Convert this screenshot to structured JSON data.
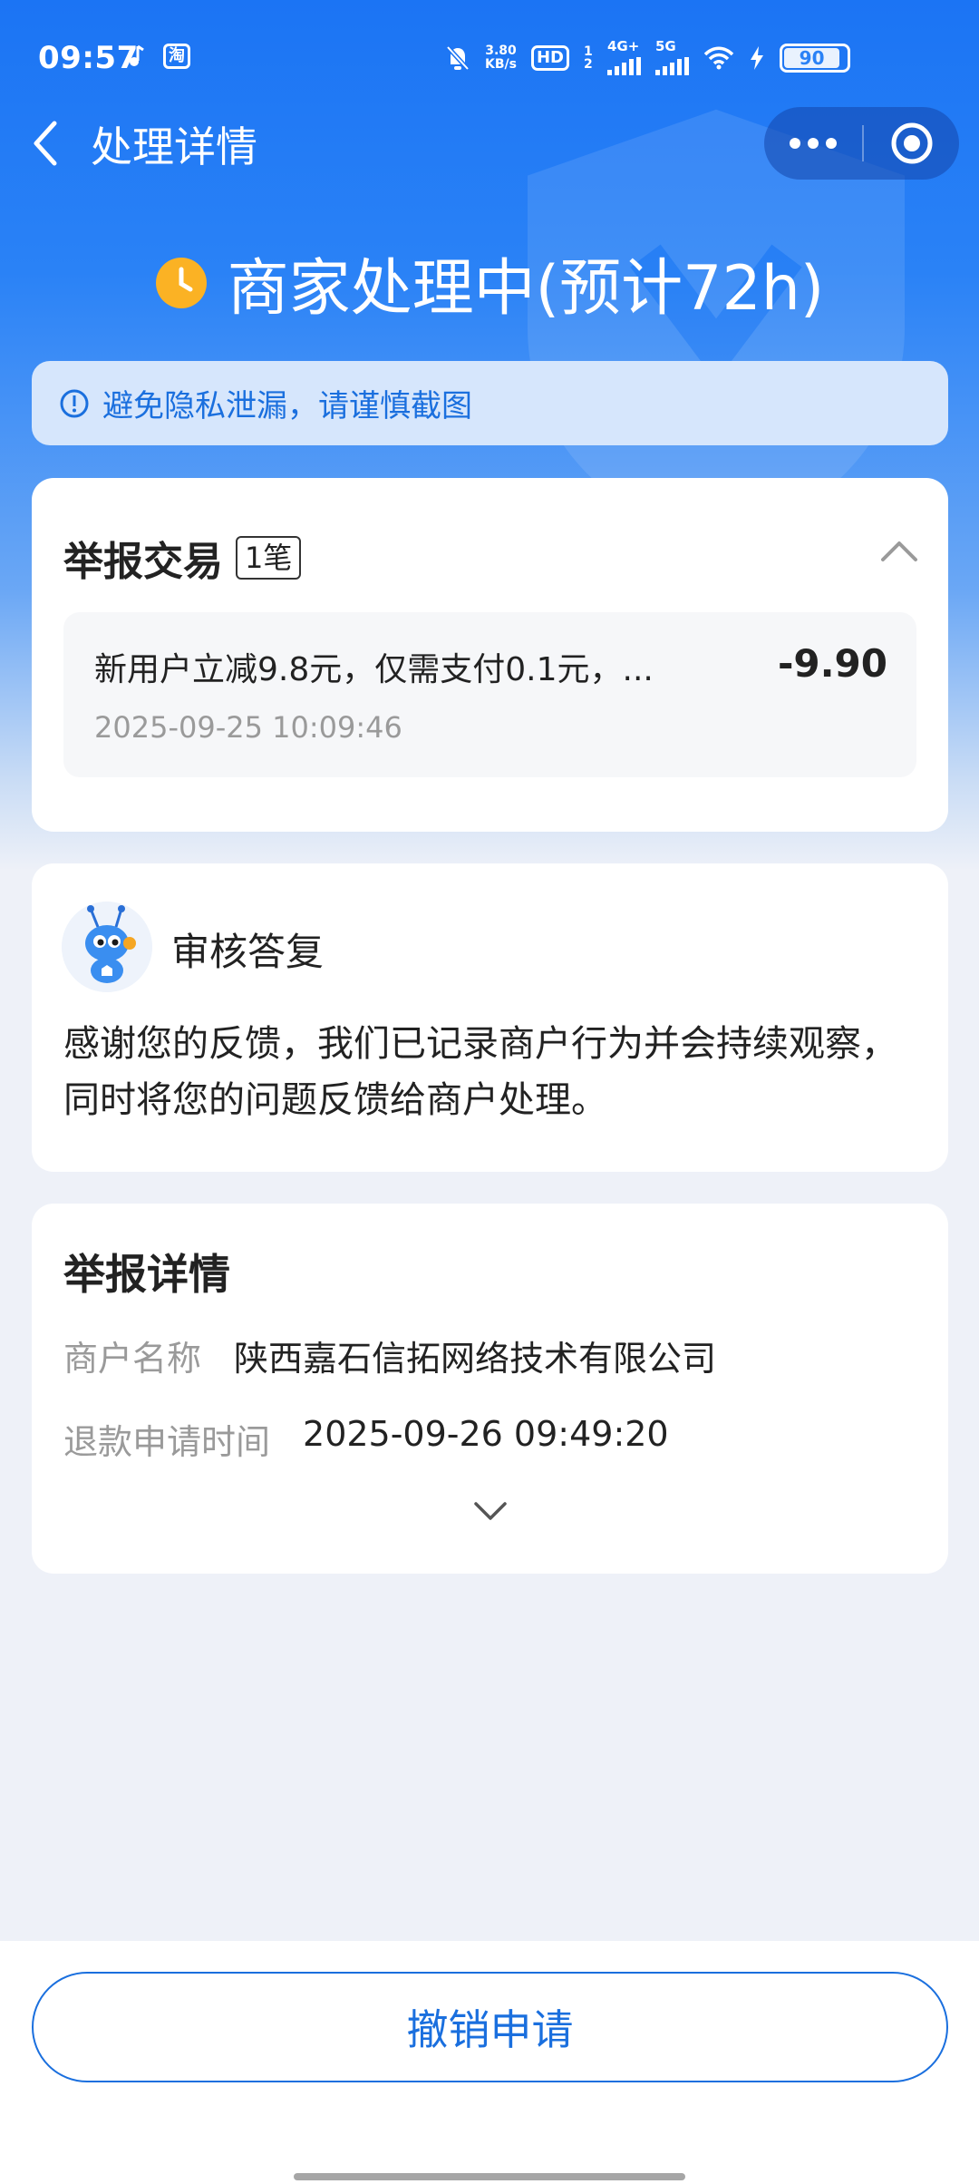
{
  "status_bar": {
    "time": "09:57",
    "taobao_badge": "淘",
    "net_speed_value": "3.80",
    "net_speed_unit": "KB/s",
    "hd_badge": "HD",
    "hd_sub": "1 2",
    "net_4g": "4G+",
    "net_5g": "5G",
    "battery_level": "90",
    "icons": [
      "music-icon",
      "taobao-icon",
      "bell-off-icon",
      "hd-icon",
      "signal-4g-icon",
      "signal-5g-icon",
      "wifi-icon",
      "charging-icon",
      "battery-icon"
    ]
  },
  "nav": {
    "title": "处理详情",
    "icons": [
      "back-chevron-icon",
      "more-dots-icon",
      "close-target-icon"
    ]
  },
  "status": {
    "text": "商家处理中(预计72h)",
    "icon": "clock-icon",
    "icon_color": "#fbb224"
  },
  "notice": {
    "text": "避免隐私泄漏，请谨慎截图",
    "icon": "info-circle-icon",
    "color": "#1a6fde"
  },
  "trade": {
    "title": "举报交易",
    "count": "1笔",
    "item": {
      "description": "新用户立减9.8元，仅需支付0.1元，...",
      "amount": "-9.90",
      "time": "2025-09-25 10:09:46"
    }
  },
  "reply": {
    "title": "审核答复",
    "body": "感谢您的反馈，我们已记录商户行为并会持续观察，同时将您的问题反馈给商户处理。",
    "avatar_icon": "ant-mascot-icon"
  },
  "detail": {
    "title": "举报详情",
    "merchant_label": "商户名称",
    "merchant_value": "陕西嘉石信拓网络技术有限公司",
    "refund_label": "退款申请时间",
    "refund_value": "2025-09-26 09:49:20"
  },
  "actions": {
    "cancel_label": "撤销申请"
  },
  "colors": {
    "primary": "#1a6fde",
    "header_blue": "#1b74f4",
    "background": "#eef1f8"
  }
}
